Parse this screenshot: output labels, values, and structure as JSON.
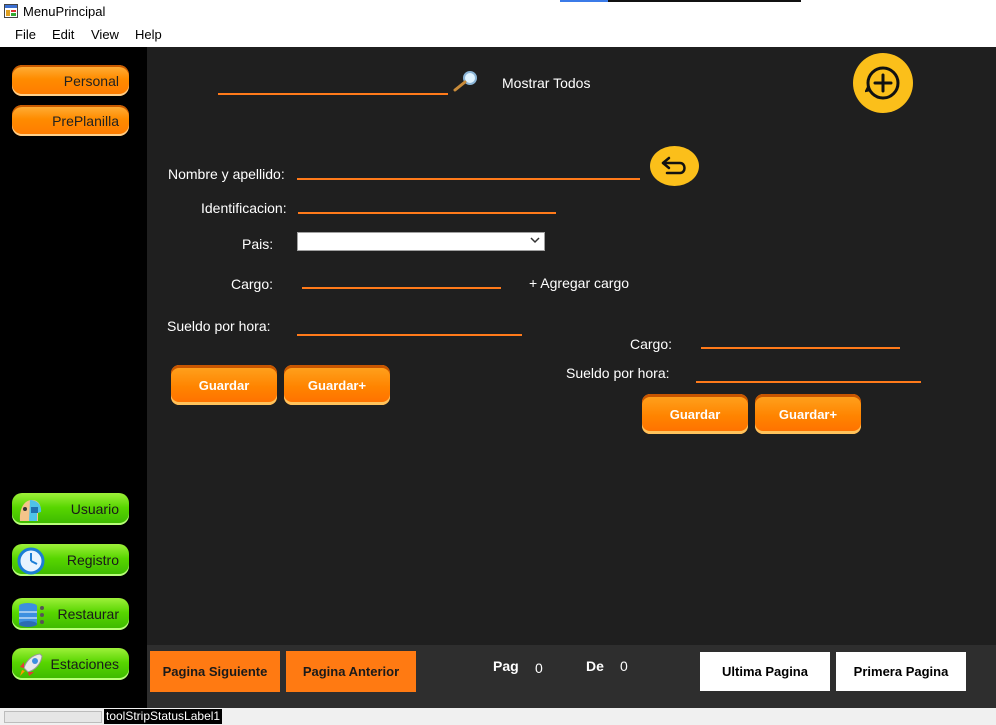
{
  "window": {
    "title": "MenuPrincipal"
  },
  "menu": {
    "file": "File",
    "edit": "Edit",
    "view": "View",
    "help": "Help"
  },
  "sidebar": {
    "personal": "Personal",
    "preplanilla": "PrePlanilla",
    "usuario": "Usuario",
    "registro": "Registro",
    "restaurar": "Restaurar",
    "estaciones": "Estaciones"
  },
  "search": {
    "value": "",
    "show_all": "Mostrar Todos"
  },
  "form": {
    "nombre_label": "Nombre y apellido:",
    "nombre_value": "",
    "identificacion_label": "Identificacion:",
    "identificacion_value": "",
    "pais_label": "Pais:",
    "pais_value": "",
    "cargo_label": "Cargo:",
    "cargo_value": "",
    "agregar_cargo": "+ Agregar cargo",
    "sueldo_label": "Sueldo por hora:",
    "sueldo_value": "",
    "guardar": "Guardar",
    "guardar_plus": "Guardar+"
  },
  "cargo_panel": {
    "cargo_label": "Cargo:",
    "cargo_value": "",
    "sueldo_label": "Sueldo por hora:",
    "sueldo_value": "",
    "guardar": "Guardar",
    "guardar_plus": "Guardar+"
  },
  "pagination": {
    "siguiente": "Pagina Siguiente",
    "anterior": "Pagina Anterior",
    "pag_label": "Pag",
    "pag_value": "0",
    "de_label": "De",
    "de_value": "0",
    "ultima": "Ultima Pagina",
    "primera": "Primera Pagina"
  },
  "status": {
    "label": "toolStripStatusLabel1"
  },
  "icons": {
    "app": "app-window-icon",
    "search": "magnifier-icon",
    "add": "plus-circle-icon",
    "back": "undo-arrow-icon",
    "dropdown": "chevron-down-icon",
    "usuario": "user-head-icon",
    "registro": "clock-icon",
    "restaurar": "database-icon",
    "estaciones": "rocket-icon"
  },
  "colors": {
    "accent_orange": "#ff7a12",
    "accent_yellow": "#fbbf1a",
    "sidebar_green": "#58d600",
    "background": "#1f1f1f",
    "sidebar_bg": "#000000"
  }
}
